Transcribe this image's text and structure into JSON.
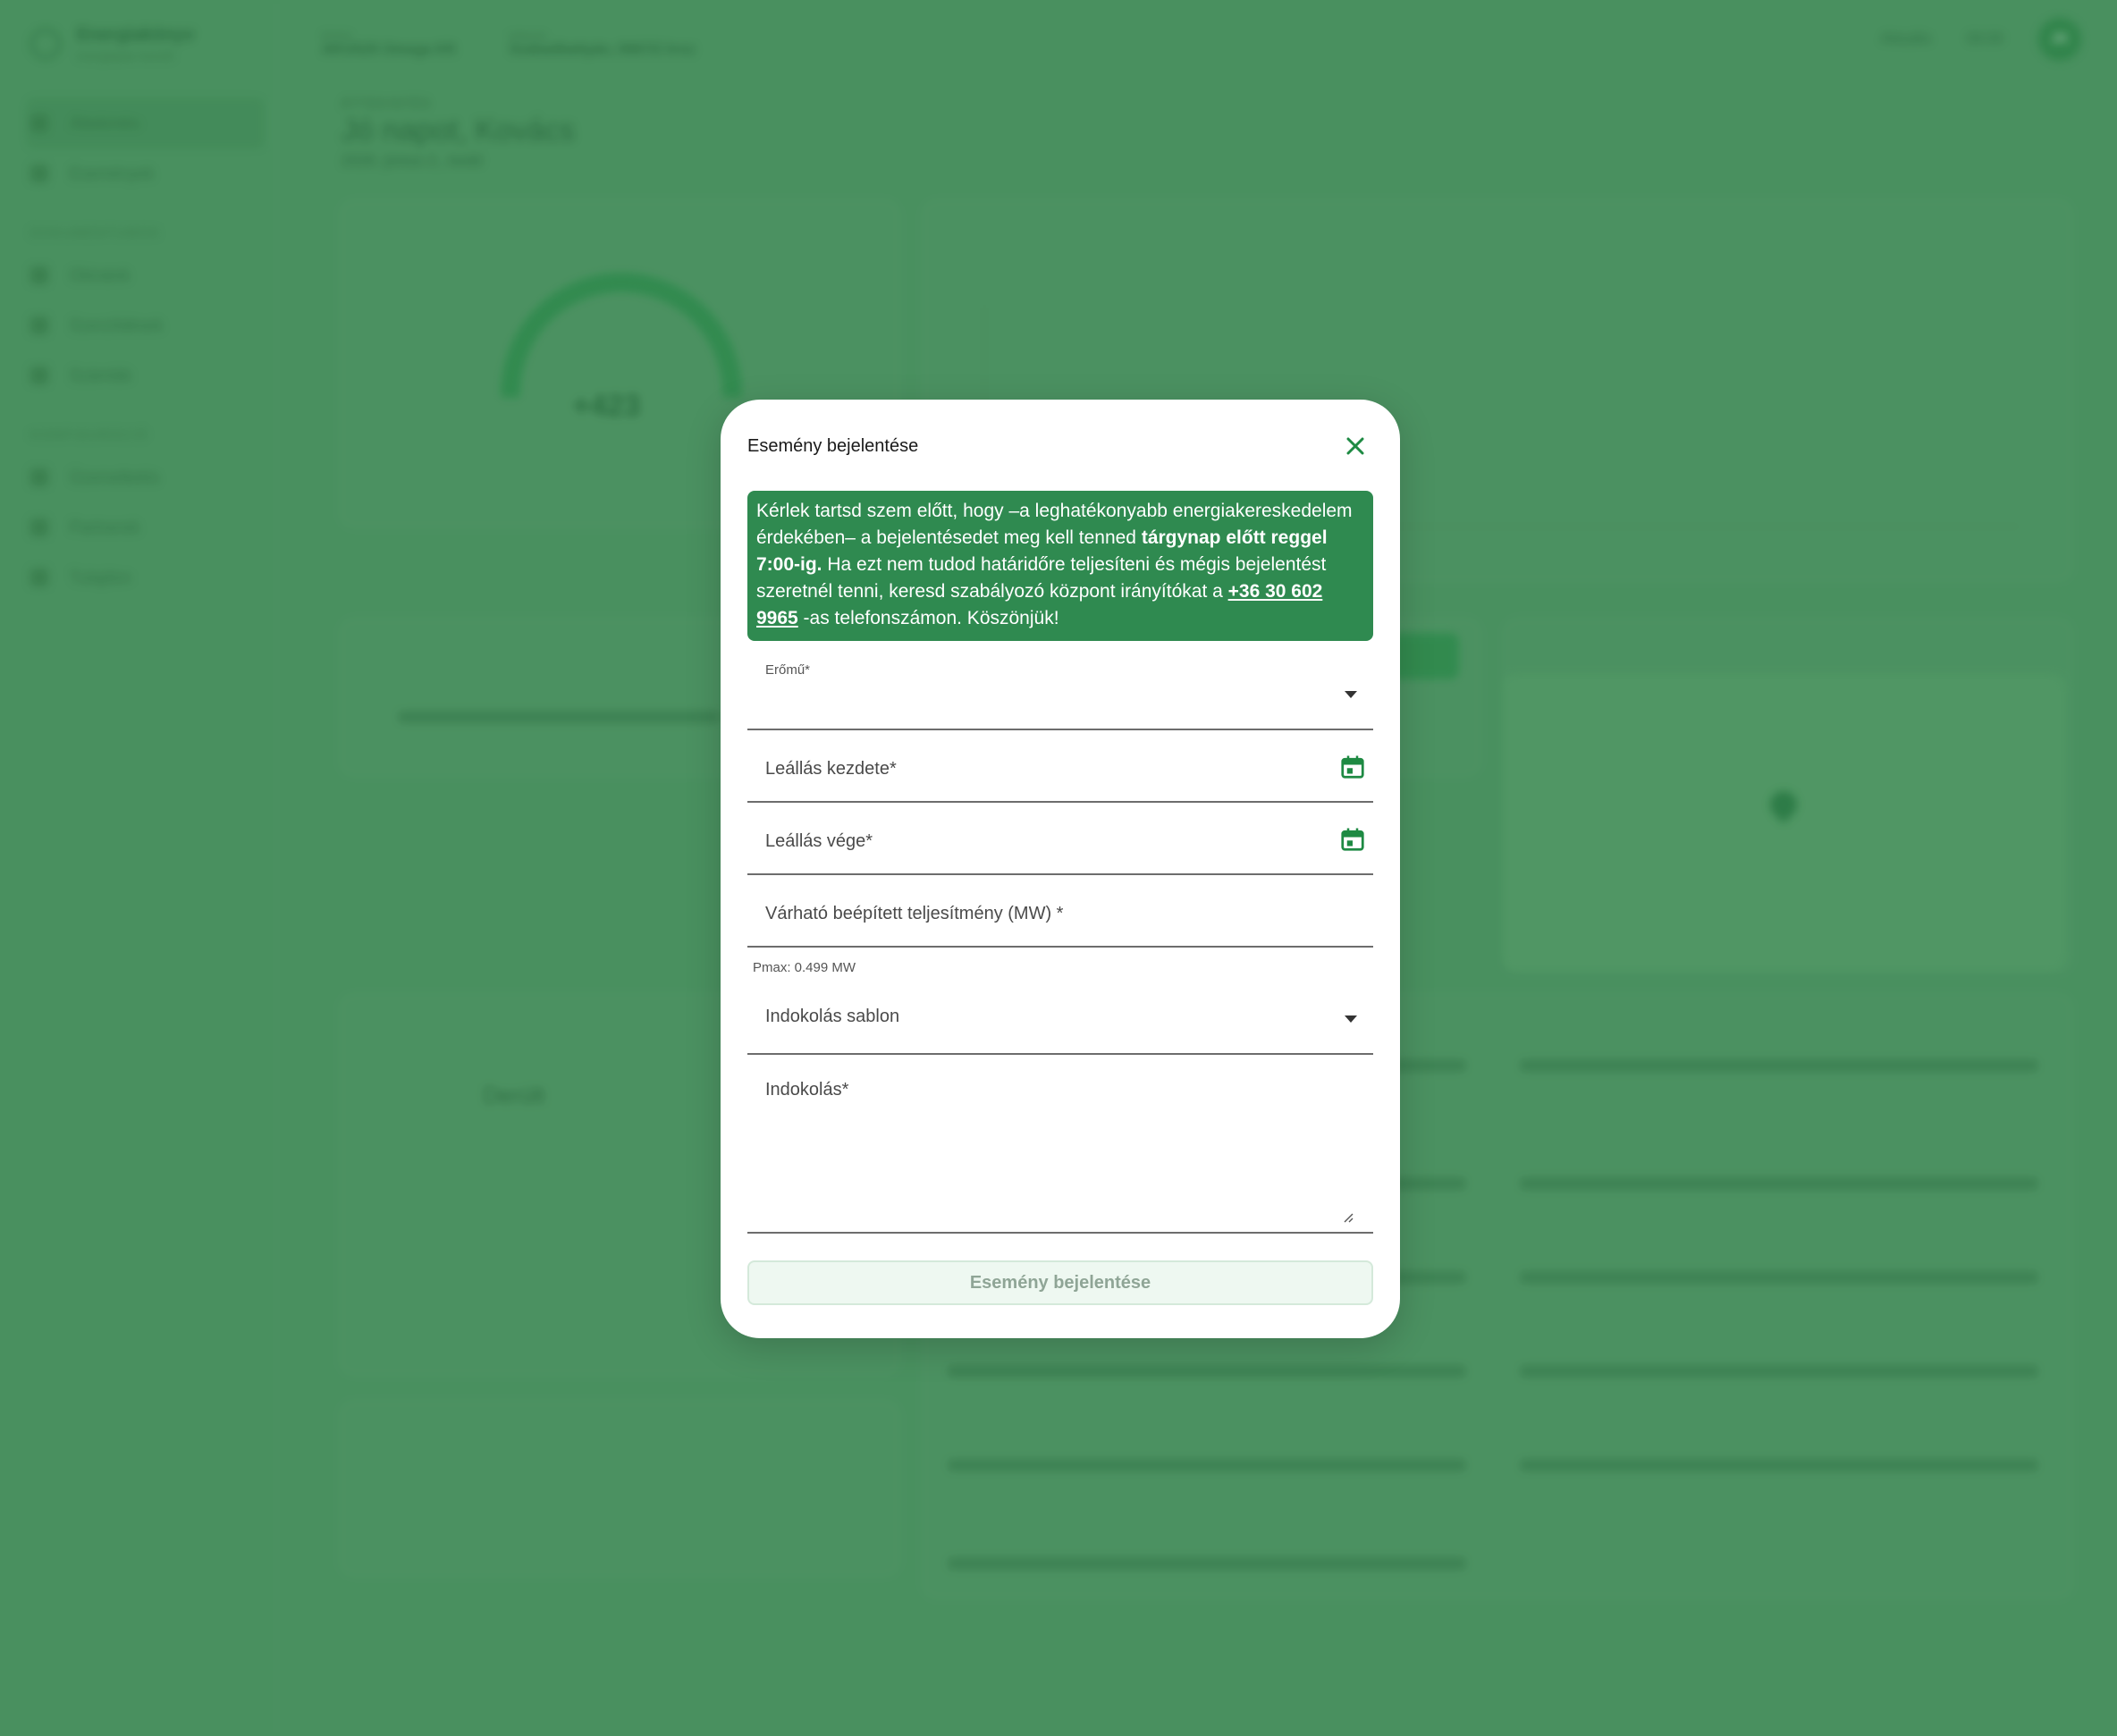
{
  "background": {
    "brand_name": "Energiakönyv",
    "brand_sub": "energiapiac kezelő",
    "nav_items": [
      "Áttekintés",
      "Események"
    ],
    "nav_section_1": "DOKUMENTUMOK",
    "nav_items_2": [
      "Okiratok",
      "Szerződések",
      "Számlák"
    ],
    "nav_section_2": "KONFIGURÁCIÓ",
    "nav_items_3": [
      "Üzemeltetés",
      "Partnerek",
      "Tulajdon"
    ],
    "plant_selector_label": "Erőmű",
    "plant_selector_value": "AKUSZ0 Omega Kft",
    "location_selector_label": "Helyszín",
    "location_selector_value": "Szabadbattyán, 0967/2 hrsz",
    "clock_label": "Aktuális",
    "clock_value": "09:09",
    "avatar_initials": "JK",
    "greeting_small": "ÁTTEKINTÉS",
    "greeting_title": "Jó napot, Kovács",
    "greeting_date": "2026. június 2., kedd",
    "gauge_value": "+423",
    "weather_label": "Derült"
  },
  "modal": {
    "title": "Esemény bejelentése",
    "notice": {
      "part1": "Kérlek tartsd szem előtt, hogy –a leghatékonyabb energiakereskedelem érdekében– a bejelentésedet meg kell tenned ",
      "bold": "tárgynap előtt reggel 7:00-ig.",
      "part2": " Ha ezt nem tudod határidőre teljesíteni és mégis bejelentést szeretnél tenni, keresd szabályozó központ irányítókat a ",
      "phone": "+36 30 602 9965",
      "part3": " -as telefonszámon. Köszönjük!"
    },
    "plant_field_label": "Erőmű*",
    "start_field_label": "Leállás kezdete*",
    "end_field_label": "Leállás vége*",
    "capacity_field_label": "Várható beépített teljesítmény (MW) *",
    "capacity_helper": "Pmax: 0.499 MW",
    "template_field_label": "Indokolás sablon",
    "reason_field_label": "Indokolás*",
    "submit_label": "Esemény bejelentése"
  },
  "colors": {
    "accent": "#1e8a43",
    "notice_bg": "#2f8a50",
    "backdrop": "#4f9464"
  }
}
